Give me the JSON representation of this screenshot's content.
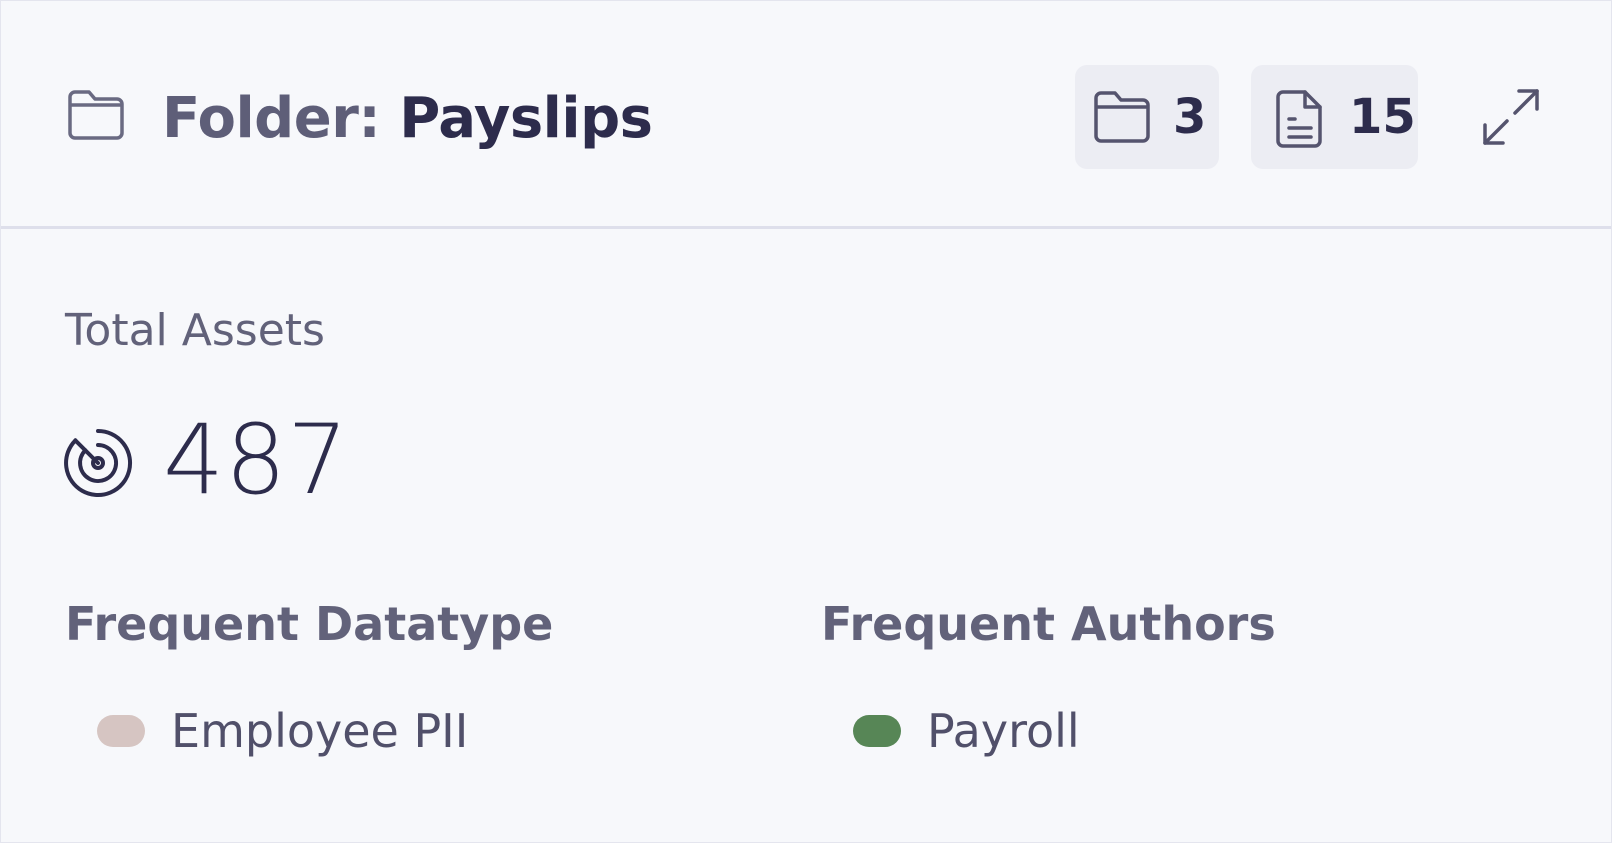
{
  "header": {
    "title_prefix": "Folder: ",
    "title_name": "Payslips",
    "title_icon": "folder-icon",
    "folder_count": "3",
    "folder_count_icon": "folder-icon",
    "file_count": "15",
    "file_count_icon": "document-icon",
    "expand_icon": "expand-icon"
  },
  "total_assets": {
    "label": "Total Assets",
    "value": "487",
    "icon": "radar-icon"
  },
  "frequent_datatype": {
    "heading": "Frequent Datatype",
    "items": [
      {
        "label": "Employee PII",
        "color": "#d6c5c2"
      }
    ]
  },
  "frequent_authors": {
    "heading": "Frequent Authors",
    "items": [
      {
        "label": "Payroll",
        "color": "#578656"
      }
    ]
  },
  "colors": {
    "background": "#f7f8fb",
    "divider": "#dedfeb",
    "chip_background": "#ecedf3",
    "text_dark": "#2d2c4c",
    "text_muted": "#62627a"
  }
}
